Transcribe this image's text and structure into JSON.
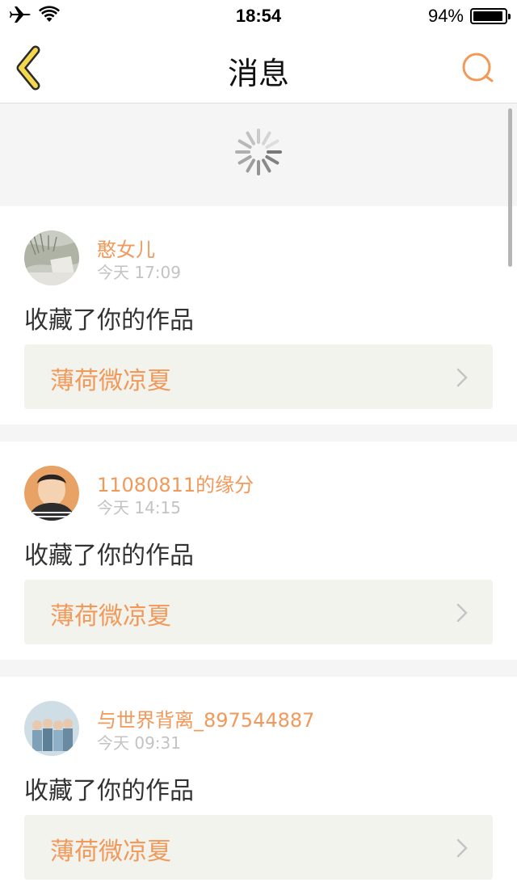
{
  "status_bar": {
    "time": "18:54",
    "battery_text": "94%",
    "battery_level": 0.94
  },
  "nav": {
    "title": "消息",
    "back_icon": "chevron-left-icon",
    "search_icon": "search-icon"
  },
  "colors": {
    "accent": "#f2995a",
    "nav_icon_yellow": "#f3d74e"
  },
  "messages": [
    {
      "sender": "憨女儿",
      "time": "今天 17:09",
      "action": "收藏了你的作品",
      "work_title": "薄荷微凉夏"
    },
    {
      "sender": "11080811的缘分",
      "time": "今天 14:15",
      "action": "收藏了你的作品",
      "work_title": "薄荷微凉夏"
    },
    {
      "sender": "与世界背离_897544887",
      "time": "今天 09:31",
      "action": "收藏了你的作品",
      "work_title": "薄荷微凉夏"
    }
  ]
}
